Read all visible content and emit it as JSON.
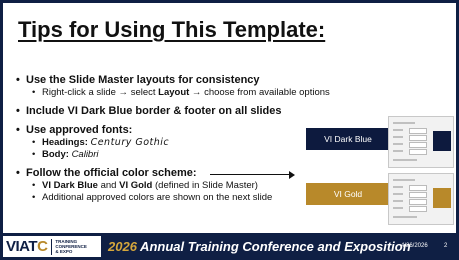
{
  "slide": {
    "title": "Tips for Using This Template:",
    "bullets": {
      "b1": "Use the Slide Master layouts for consistency",
      "b1_sub_pre": "Right-click a slide → select ",
      "b1_sub_key": "Layout",
      "b1_sub_post": " → choose from available options",
      "b2": "Include VI Dark Blue border & footer on all slides",
      "b3": "Use approved fonts:",
      "b3_sub1_key": "Headings:",
      "b3_sub1_val": "Century Gothic",
      "b3_sub2_key": "Body:",
      "b3_sub2_val": "Calibri",
      "b4": "Follow the official color scheme:",
      "b4_sub1_key1": "VI Dark Blue",
      "b4_sub1_and": " and ",
      "b4_sub1_key2": "VI Gold",
      "b4_sub1_post": " (defined in Slide Master)",
      "b4_sub2": "Additional approved colors are shown on the next slide"
    },
    "swatches": {
      "blue_label": "VI Dark Blue",
      "gold_label": "VI Gold"
    }
  },
  "colors": {
    "vi_dark_blue": "#0d1a3e",
    "vi_gold": "#b8892a",
    "border": "#0f1f44"
  },
  "footer": {
    "logo_main": "VIAT",
    "logo_accent": "C",
    "logo_sub1": "TRAINING",
    "logo_sub2": "CONFERENCE",
    "logo_sub3": "& EXPO",
    "year": "2026",
    "title": " Annual Training Conference and Exposition",
    "date": "4/26/2026",
    "page": "2"
  }
}
